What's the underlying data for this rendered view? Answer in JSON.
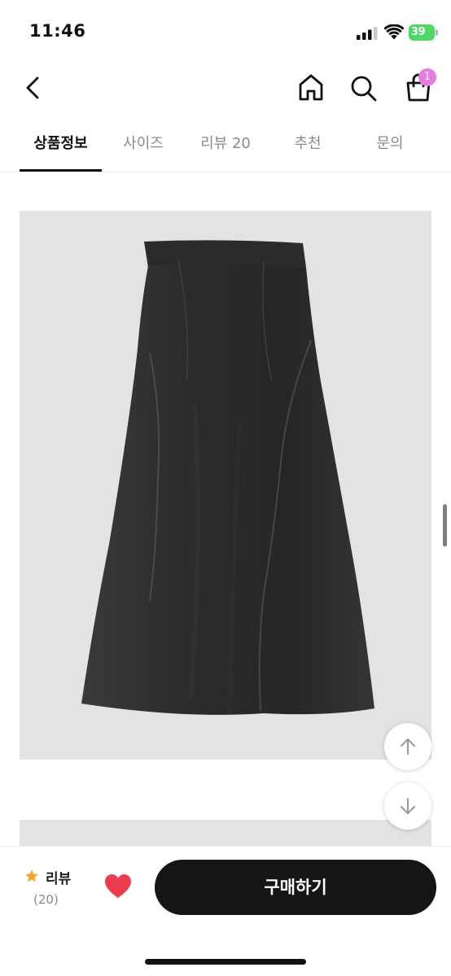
{
  "status_bar": {
    "time": "11:46",
    "battery_percent": "39",
    "icons": [
      "signal-icon",
      "wifi-icon",
      "battery-icon"
    ]
  },
  "nav": {
    "icons": [
      "chevron-left-icon",
      "home-icon",
      "search-icon",
      "shopping-bag-icon"
    ],
    "cart_badge": "1"
  },
  "tabs": [
    {
      "label": "상품정보",
      "active": true
    },
    {
      "label": "사이즈",
      "active": false
    },
    {
      "label": "리뷰 20",
      "active": false
    },
    {
      "label": "추천",
      "active": false
    },
    {
      "label": "문의",
      "active": false
    }
  ],
  "product": {
    "image_subject": "black long skirt",
    "image_background": "#e3e3e3",
    "skirt_color": "#2a2a2a"
  },
  "scroll_buttons": {
    "icons": [
      "arrow-up-icon",
      "arrow-down-icon"
    ]
  },
  "bottom_bar": {
    "review_label": "리뷰",
    "review_count": "(20)",
    "star_color": "#f5a623",
    "heart_color": "#ef3b4e",
    "buy_label": "구매하기"
  }
}
